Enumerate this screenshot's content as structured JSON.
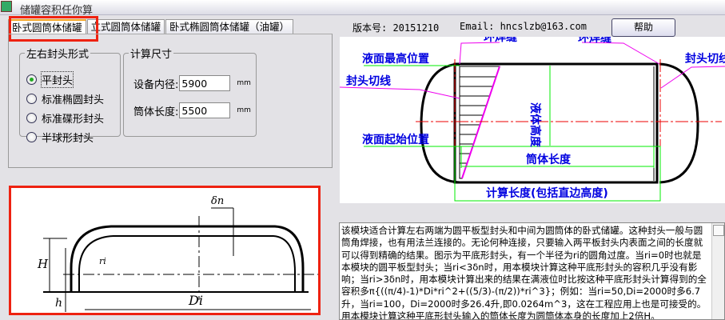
{
  "window": {
    "title": "储罐容积任你算"
  },
  "tabs": [
    {
      "label": "卧式圆筒体储罐"
    },
    {
      "label": "立式圆筒体储罐"
    },
    {
      "label": "卧式椭圆筒体储罐（油罐）"
    }
  ],
  "head_group": {
    "title": "左右封头形式",
    "options": [
      {
        "label": "平封头",
        "selected": true
      },
      {
        "label": "标准椭圆封头",
        "selected": false
      },
      {
        "label": "标准碟形封头",
        "selected": false
      },
      {
        "label": "半球形封头",
        "selected": false
      }
    ]
  },
  "size_group": {
    "title": "计算尺寸",
    "diameter_label": "设备内径:",
    "diameter_value": "5900",
    "length_label": "筒体长度:",
    "length_value": "5500",
    "unit": "mm"
  },
  "info": {
    "version": "版本号: 20151210",
    "email": "Email: hncslzb@163.com",
    "help_label": "帮助"
  },
  "diagram": {
    "weld1": "环焊缝",
    "weld2": "环焊缝",
    "max_level": "液面最高位置",
    "cut_left": "封头切线",
    "cut_right": "封头切线",
    "min_level": "液面起始位置",
    "liquid_height": "液体高度",
    "shell_length": "筒体长度",
    "calc_length": "计算长度(包括直边高度)"
  },
  "head_drawing": {
    "delta": "δn",
    "H": "H",
    "h": "h",
    "r": "ri",
    "D": "Di"
  },
  "description": "该模块适合计算左右两端为圆平板型封头和中间为圆筒体的卧式储罐。这种封头一般与圆筒角焊接，也有用法兰连接的。无论何种连接，只要输入两平板封头内表面之间的长度就可以得到精确的结果。图示为平底形封头，有一个半径为ri的圆角过度。当ri=0时也就是本模块的圆平板型封头；当ri<3δn时，用本模块计算这种平底形封头的容积几乎没有影响；当ri>3δn时，用本模块计算出来的结果在满液位时比按这种平底形封头计算得到的全容积多π{((π/4)-1)*Di*ri^2+((5/3)-(π/2))*ri^3}；例如：当ri=50,Di=2000时多6.7升，当ri=100，Di=2000时多26.4升,即0.0264m^3，这在工程应用上也是可接受的。用本模块计算这种平底形封头输入的筒体长度为圆筒体本身的长度加上2倍H。"
}
